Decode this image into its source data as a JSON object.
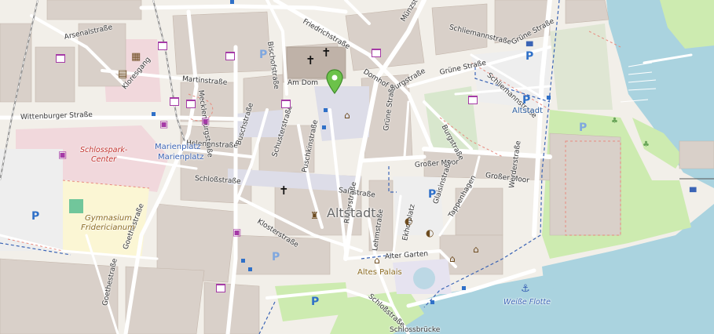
{
  "streets": {
    "arsenalstrasse": "Arsenalstraße",
    "bischofstrasse": "Bischofstraße",
    "friedrichstrasse": "Friedrichstraße",
    "muenzstrasse": "Münzstraße",
    "schliemannstrasse_top": "Schliemannstraße",
    "gruene_strasse_ne": "Grüne Straße",
    "kloresgang": "Kloresgang",
    "martinstrasse": "Martinstraße",
    "am_dom": "Am Dom",
    "domhof": "Domhof",
    "burgstrasse_top": "Burgstraße",
    "gruene_strasse_mid": "Grüne Straße",
    "schliemannstrasse_right": "Schliemannstraße",
    "mecklenburgstrasse": "Mecklenburgstraße",
    "wittenburger_strasse": "Wittenburger Straße",
    "helenenstrasse": "Helenenstraße",
    "buschstrasse": "Buschstraße",
    "gruene_strasse_vertical": "Grüne Straße",
    "burgstrasse_diag": "Burgstraße",
    "schlossstrasse": "Schloßstraße",
    "schusterstrasse": "Schusterstraße",
    "puschkinstrasse": "Puschkinstraße",
    "grosser_moor_left": "Großer Moor",
    "grosser_moor_right": "Großer Moor",
    "salzstrasse": "Salzstraße",
    "glaisinstrasse": "Glaisinstraße",
    "tappenhagen": "Tappenhagen",
    "kuetersstrasse": "Klosterstraße",
    "ritterstrasse": "Ritterstraße",
    "lehmstrasse": "Lehmstraße",
    "alter_garten": "Alter Garten",
    "ekhofplatz": "Ekhofplatz",
    "werderstrasse": "Werderstraße",
    "goethestrasse_left": "Goethestraße",
    "goethestrasse_right": "Goethestraße",
    "schlossstrasse_bottom": "Schloßstraße",
    "schlossbruecke": "Schlossbrücke"
  },
  "places": {
    "altstadt": "Altstadt",
    "schlosspark_center_line1": "Schlosspark-",
    "schlosspark_center_line2": "Center",
    "marienplatz_1": "Marienplatz",
    "marienplatz_2": "Marienplatz",
    "gymnasium_line1": "Gymnasium",
    "gymnasium_line2": "Fridericianum",
    "altes_palais": "Altes Palais",
    "altstadt_parking": "Altstadt",
    "weisse_flotte": "Weiße Flotte"
  },
  "symbols": {
    "parking": "P",
    "church": "✝",
    "marker": "location-marker"
  },
  "colors": {
    "background": "#f2efe9",
    "building": "#d9d0c9",
    "water": "#aad3df",
    "park": "#cdebb0",
    "pedestrian": "#dddde8",
    "road": "#ffffff",
    "marker": "#6cc24a",
    "bus_line": "#3b64b5",
    "shop": "#a53aa6"
  }
}
